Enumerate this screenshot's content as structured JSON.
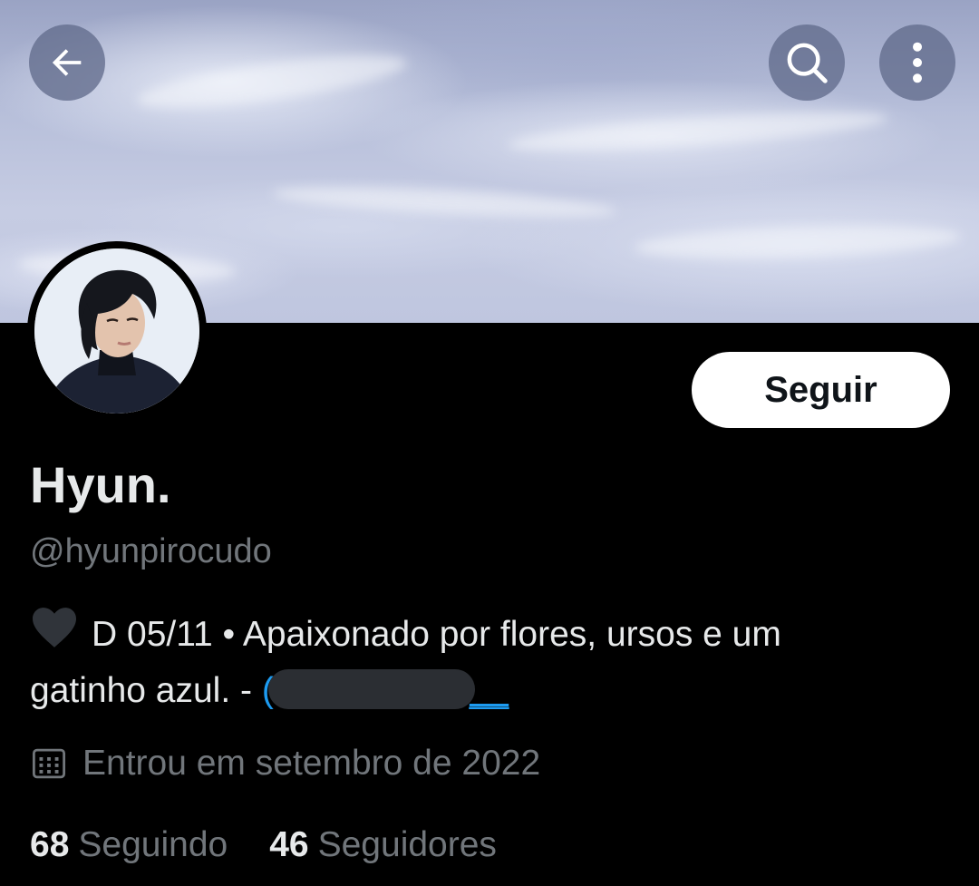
{
  "header": {
    "icons": [
      "back-arrow-icon",
      "search-icon",
      "more-vertical-icon"
    ]
  },
  "profile": {
    "display_name": "Hyun.",
    "handle": "@hyunpirocudo",
    "bio_line1": "D 05/11 • Apaixonado por flores, ursos e um",
    "bio_line2_prefix": "gatinho azul. - ",
    "bio_mention_start": "(",
    "bio_mention_end": "__",
    "bio_icon": "black-heart-icon",
    "joined_icon": "calendar-icon",
    "joined": "Entrou em setembro de 2022",
    "following_count": "68",
    "following_label": "Seguindo",
    "followers_count": "46",
    "followers_label": "Seguidores"
  },
  "actions": {
    "follow_label": "Seguir"
  },
  "colors": {
    "background": "#000000",
    "text_primary": "#e7e9ea",
    "text_secondary": "#71767b",
    "link": "#1d9bf0",
    "button_bg": "#ffffff",
    "button_text": "#0f1419"
  }
}
